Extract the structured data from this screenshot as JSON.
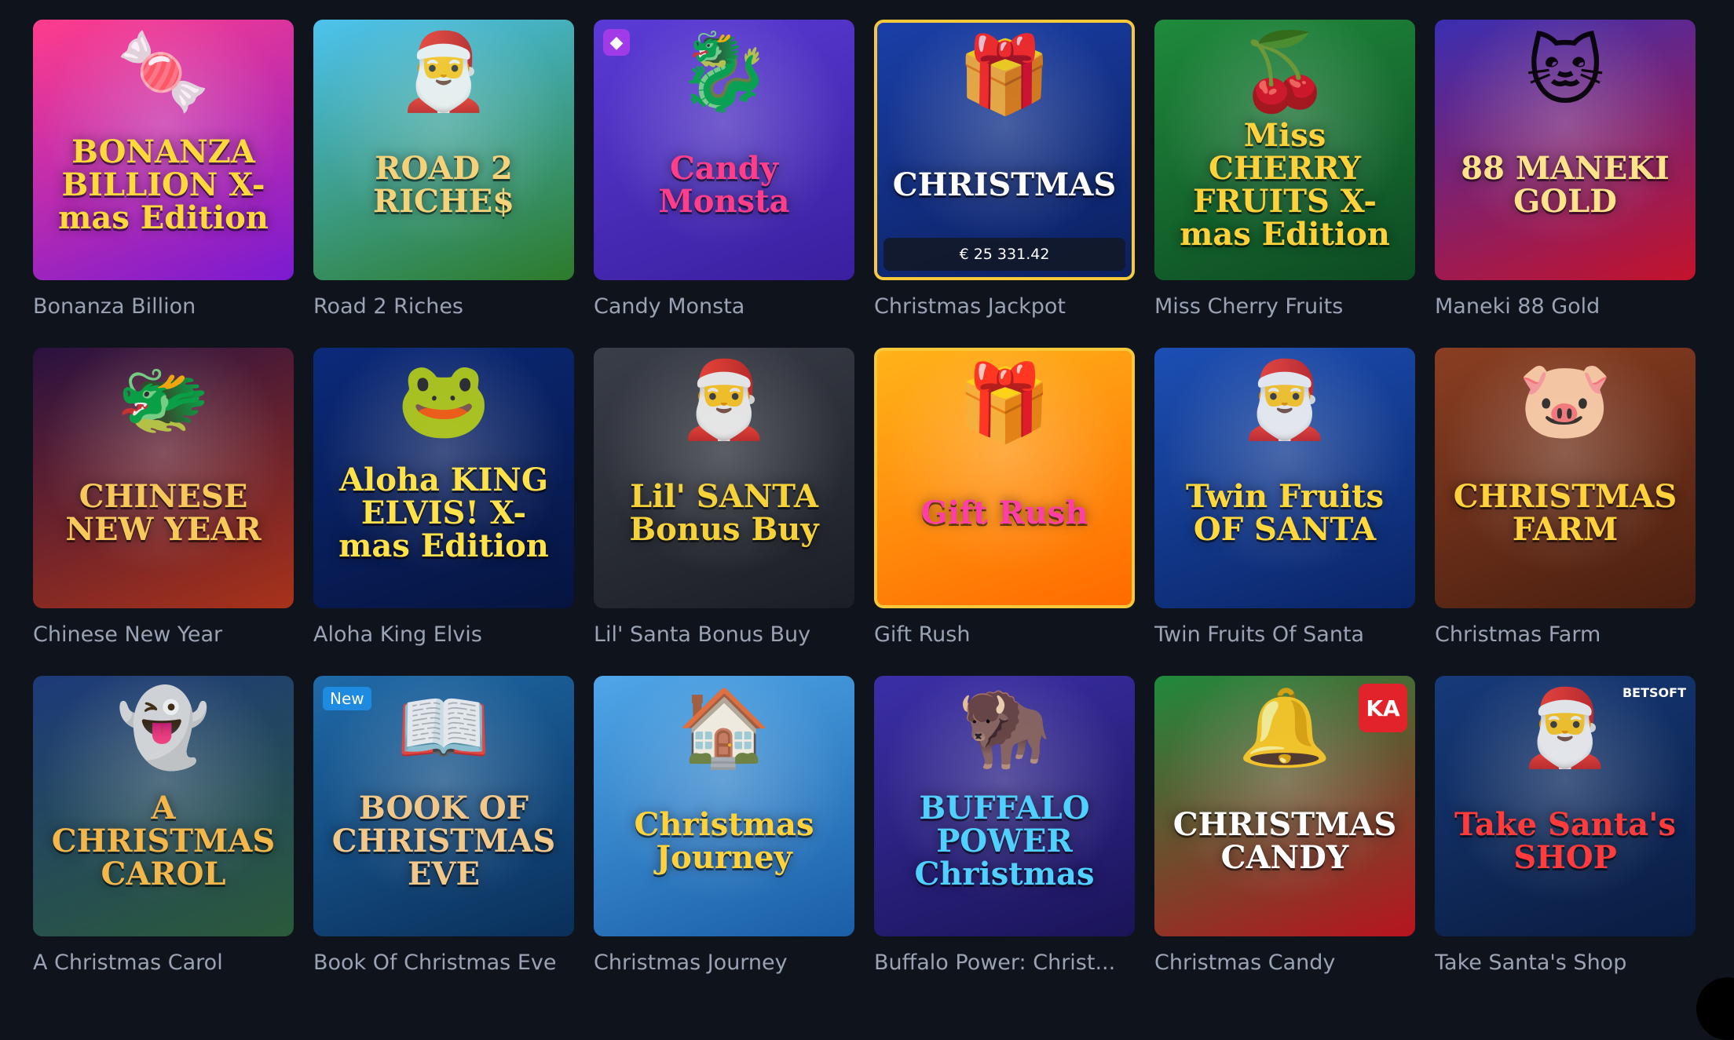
{
  "games": [
    {
      "label": "Bonanza Billion",
      "title_art": "BONANZA BILLION X-mas Edition",
      "art_icon": "🍬",
      "colors": [
        "#ff3d8c",
        "#7a1bd1"
      ],
      "title_color": "#ffd93b"
    },
    {
      "label": "Road 2 Riches",
      "title_art": "ROAD 2 RICHE$",
      "art_icon": "🎅",
      "colors": [
        "#4ec3ef",
        "#2d7a2a"
      ],
      "title_color": "#f3d27a"
    },
    {
      "label": "Candy Monsta",
      "title_art": "Candy Monsta",
      "art_icon": "🐉",
      "colors": [
        "#5b3bd6",
        "#3a1f9e"
      ],
      "title_color": "#ff3e8a",
      "badge": "gem"
    },
    {
      "label": "Christmas Jackpot",
      "title_art": "CHRISTMAS",
      "art_icon": "🎁",
      "colors": [
        "#1a3fa8",
        "#0b1f5e"
      ],
      "title_color": "#ffffff",
      "jackpot": "€ 25 331.42",
      "framed": true
    },
    {
      "label": "Miss Cherry Fruits",
      "title_art": "Miss CHERRY FRUITS X-mas Edition",
      "art_icon": "🍒",
      "colors": [
        "#1f8a3c",
        "#0d4a22"
      ],
      "title_color": "#ffd23b"
    },
    {
      "label": "Maneki 88 Gold",
      "title_art": "88 MANEKI GOLD",
      "art_icon": "🐱",
      "colors": [
        "#3a2fb2",
        "#c4132b"
      ],
      "title_color": "#ffe38a"
    },
    {
      "label": "Chinese New Year",
      "title_art": "CHINESE NEW YEAR",
      "art_icon": "🐲",
      "colors": [
        "#2a1240",
        "#a8321a"
      ],
      "title_color": "#f7c85a"
    },
    {
      "label": "Aloha King Elvis",
      "title_art": "Aloha KING ELVIS! X-mas Edition",
      "art_icon": "🐸",
      "colors": [
        "#0b2a7a",
        "#06143f"
      ],
      "title_color": "#ffe24a"
    },
    {
      "label": "Lil' Santa Bonus Buy",
      "title_art": "Lil' SANTA Bonus Buy",
      "art_icon": "🎅",
      "colors": [
        "#3a3e48",
        "#1b1e25"
      ],
      "title_color": "#f5d13a"
    },
    {
      "label": "Gift Rush",
      "title_art": "Gift Rush",
      "art_icon": "🎁",
      "colors": [
        "#ffb31a",
        "#ff6a00"
      ],
      "title_color": "#ff3fa6",
      "framed": true
    },
    {
      "label": "Twin Fruits Of Santa",
      "title_art": "Twin Fruits OF SANTA",
      "art_icon": "🎅",
      "colors": [
        "#1c4fb4",
        "#0a2466"
      ],
      "title_color": "#ffd93b"
    },
    {
      "label": "Christmas Farm",
      "title_art": "CHRISTMAS FARM",
      "art_icon": "🐷",
      "colors": [
        "#8a3e22",
        "#4a1f10"
      ],
      "title_color": "#ffd23b"
    },
    {
      "label": "A Christmas Carol",
      "title_art": "A CHRISTMAS CAROL",
      "art_icon": "👻",
      "colors": [
        "#1d3a7a",
        "#2b5a3a"
      ],
      "title_color": "#f3b64a"
    },
    {
      "label": "Book Of Christmas Eve",
      "title_art": "BOOK OF CHRISTMAS EVE",
      "art_icon": "📖",
      "colors": [
        "#1f6aa8",
        "#0a2f5a"
      ],
      "title_color": "#f2c78a",
      "badge": "new",
      "badge_text": "New"
    },
    {
      "label": "Christmas Journey",
      "title_art": "Christmas Journey",
      "art_icon": "🏠",
      "colors": [
        "#4fa6e8",
        "#1a5ea8"
      ],
      "title_color": "#ffd23b"
    },
    {
      "label": "Buffalo Power: Christ...",
      "title_art": "BUFFALO POWER Christmas",
      "art_icon": "🦬",
      "colors": [
        "#3b2fa8",
        "#1a1458"
      ],
      "title_color": "#4fd0ff"
    },
    {
      "label": "Christmas Candy",
      "title_art": "CHRISTMAS CANDY",
      "art_icon": "🔔",
      "colors": [
        "#1f8a3c",
        "#b8141e"
      ],
      "title_color": "#ffffff",
      "badge": "ka",
      "badge_text": "KA"
    },
    {
      "label": "Take Santa's Shop",
      "title_art": "Take Santa's SHOP",
      "art_icon": "🎅",
      "colors": [
        "#163a7a",
        "#0a1c40"
      ],
      "title_color": "#ff3b3b",
      "badge": "provider",
      "badge_text": "BETSOFT"
    }
  ]
}
